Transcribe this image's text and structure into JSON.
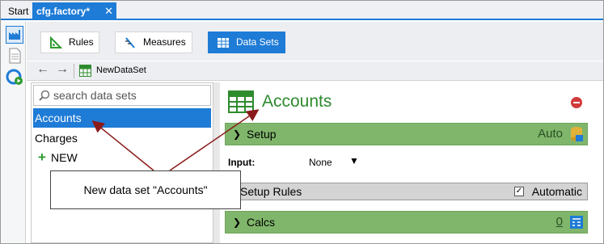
{
  "tabs": {
    "start": "Start",
    "active": "cfg.factory*",
    "close": "✕"
  },
  "toolbar": {
    "rules": "Rules",
    "measures": "Measures",
    "datasets": "Data Sets"
  },
  "nav": {
    "current": "NewDataSet"
  },
  "left": {
    "search_placeholder": "search data sets",
    "items": [
      "Accounts",
      "Charges"
    ],
    "new_label": "NEW"
  },
  "right": {
    "title": "Accounts",
    "setup": {
      "label": "Setup",
      "right": "Auto"
    },
    "input_label": "Input:",
    "input_value": "None",
    "rules": {
      "label": "Setup Rules",
      "automatic": "Automatic"
    },
    "calcs": {
      "label": "Calcs",
      "right": "0"
    }
  },
  "callout": {
    "text": "New data set \"Accounts\""
  },
  "colors": {
    "accent": "#1e7bd6",
    "green": "#2e8b2e",
    "section": "#80b66b",
    "arrow": "#8b1a1a"
  }
}
